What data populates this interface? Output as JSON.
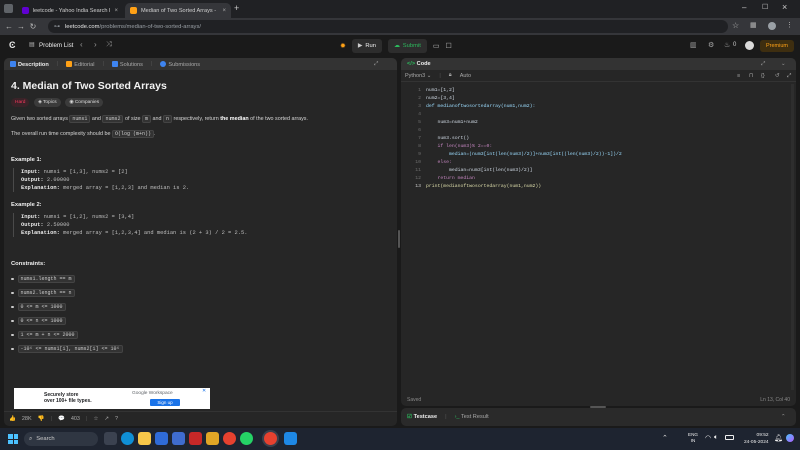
{
  "browser": {
    "tabs": [
      {
        "label": "leetcode - Yahoo India Search R",
        "favicon_color": "#6001d2",
        "active": false
      },
      {
        "label": "Median of Two Sorted Arrays - ",
        "favicon_color": "#ffa116",
        "active": true
      }
    ],
    "new_tab": "+",
    "url_host": "leetcode.com",
    "url_path": "/problems/median-of-two-sorted-arrays/"
  },
  "topbar": {
    "problem_list": "Problem List",
    "run": "Run",
    "submit": "Submit",
    "streak": "0",
    "premium": "Premium"
  },
  "desc_panel": {
    "tabs": [
      "Description",
      "Editorial",
      "Solutions",
      "Submissions"
    ],
    "title": "4. Median of Two Sorted Arrays",
    "difficulty": "Hard",
    "pill_topics": "Topics",
    "pill_companies": "Companies",
    "p1_a": "Given two sorted arrays ",
    "p1_c1": "nums1",
    "p1_b": " and ",
    "p1_c2": "nums2",
    "p1_c": " of size ",
    "p1_m": "m",
    "p1_d": " and ",
    "p1_n": "n",
    "p1_e": " respectively, return ",
    "p1_bold": "the median",
    "p1_f": " of the two sorted arrays.",
    "p2_a": "The overall run time complexity should be ",
    "p2_code": "O(log (m+n))",
    "p2_b": ".",
    "ex1_head": "Example 1:",
    "ex1_input_k": "Input:",
    "ex1_input_v": " nums1 = [1,3], nums2 = [2]",
    "ex1_output_k": "Output:",
    "ex1_output_v": " 2.00000",
    "ex1_expl_k": "Explanation:",
    "ex1_expl_v": " merged array = [1,2,3] and median is 2.",
    "ex2_head": "Example 2:",
    "ex2_input_k": "Input:",
    "ex2_input_v": " nums1 = [1,2], nums2 = [3,4]",
    "ex2_output_k": "Output:",
    "ex2_output_v": " 2.50000",
    "ex2_expl_k": "Explanation:",
    "ex2_expl_v": " merged array = [1,2,3,4] and median is (2 + 3) / 2 = 2.5.",
    "constraints_head": "Constraints:",
    "constraints": [
      "nums1.length == m",
      "nums2.length == n",
      "0 <= m <= 1000",
      "0 <= n <= 1000",
      "1 <= m + n <= 2000",
      "-10⁶ <= nums1[i], nums2[i] <= 10⁶"
    ],
    "ad_text_1": "Securely store",
    "ad_text_2": "over 100+ file types.",
    "ad_brand": "Google Workspace",
    "ad_button": "Sign up",
    "likes": "28K",
    "comments": "403"
  },
  "code_panel": {
    "title": "Code",
    "language": "Python3",
    "mode": "Auto",
    "lines": [
      "num1=[1,2]",
      "num2=[3,4]",
      "def medianoftwosortedarray(num1,num2):",
      "",
      "    num3=num1+num2",
      "",
      "    num3.sort()",
      "    if len(num3)% 2==0:",
      "        median=(num3[int(len(num3)/2)]+num3[int((len(num3)/2))-1])/2",
      "    else:",
      "        median=num3[int(len(num3)/2)]",
      "    return median",
      "print(medianoftwosortedarray(num1,num2))"
    ],
    "saved": "Saved",
    "position": "Ln 13, Col 40"
  },
  "testcase_panel": {
    "tab1": "Testcase",
    "tab2": "Test Result"
  },
  "taskbar": {
    "search": "Search",
    "lang1": "ENG",
    "lang2": "IN",
    "time": "09:52",
    "date": "24-05-2024"
  }
}
